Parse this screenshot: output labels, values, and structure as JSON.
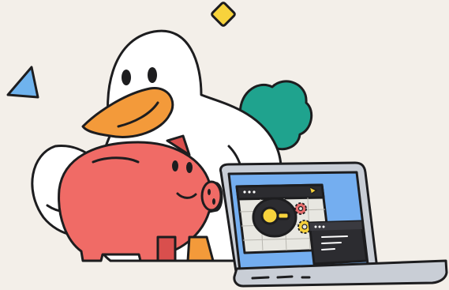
{
  "illustration": {
    "subject": "duck-hugging-piggy-bank-with-laptop",
    "colors": {
      "background": "#f3efe9",
      "outline": "#1d1d1f",
      "duck": "#ffffff",
      "beak": "#f39a3a",
      "piggy": "#f06b66",
      "piggy_shadow": "#d94f4d",
      "bush": "#1fa38e",
      "diamond": "#f7d33c",
      "triangle": "#6fb3ee",
      "laptop_body": "#c9ced6",
      "laptop_screen": "#74aef0",
      "window_bg": "#e8e7e1",
      "terminal": "#2c2c30",
      "gear_red": "#e86c6c",
      "gear_yellow": "#f5cf3a",
      "node_yellow": "#f7d33c"
    },
    "icons": [
      "diamond-shape",
      "triangle-shape",
      "bush-shape",
      "gear-icon",
      "toggle-icon",
      "terminal-window"
    ]
  }
}
